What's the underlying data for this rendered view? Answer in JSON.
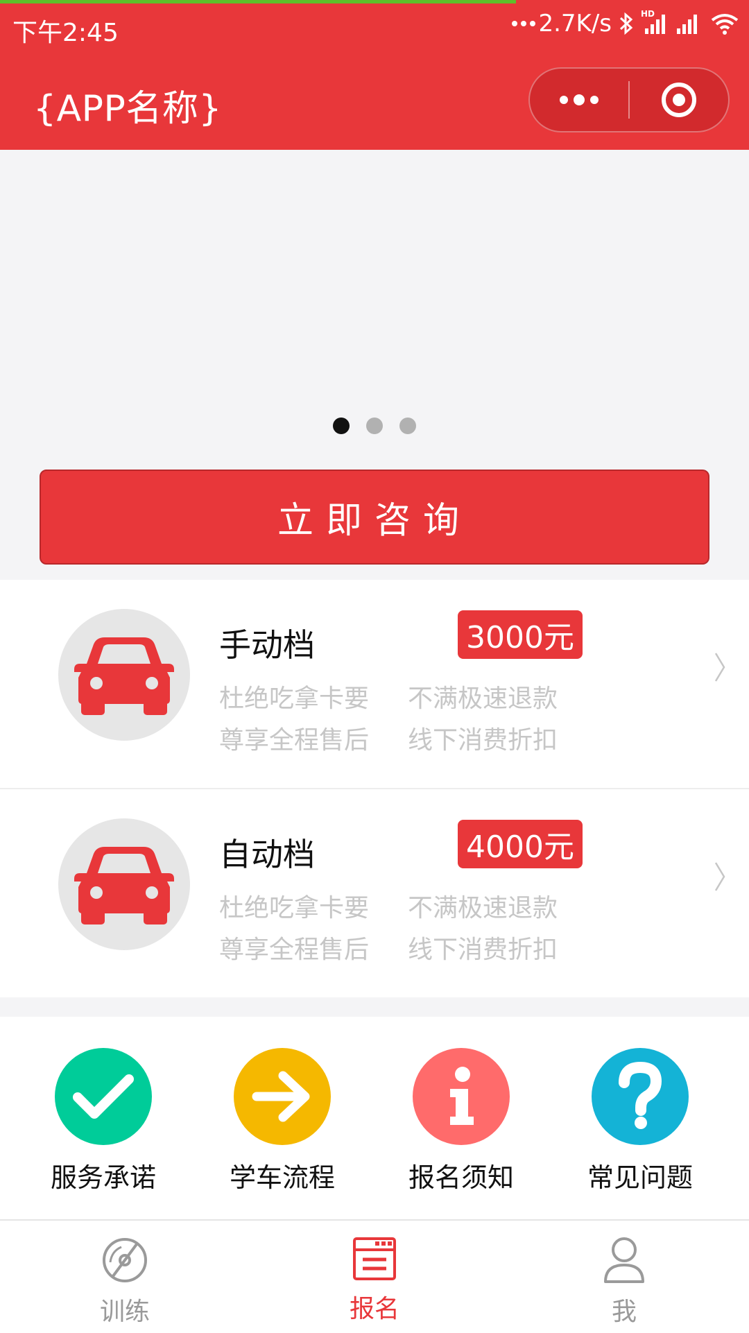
{
  "status_bar": {
    "time": "下午2:45",
    "network_speed": "2.7K/s",
    "hd_badge": "HD"
  },
  "header": {
    "app_title": "{APP名称}",
    "more_icon": "more-dots-icon",
    "close_icon": "target-circle-icon"
  },
  "banner": {
    "pages": 3,
    "active_index": 0
  },
  "consult_button": "立即咨询",
  "courses": [
    {
      "name": "手动档",
      "price": "3000元",
      "features": [
        "杜绝吃拿卡要",
        "不满极速退款",
        "尊享全程售后",
        "线下消费折扣"
      ]
    },
    {
      "name": "自动档",
      "price": "4000元",
      "features": [
        "杜绝吃拿卡要",
        "不满极速退款",
        "尊享全程售后",
        "线下消费折扣"
      ]
    }
  ],
  "services": [
    {
      "label": "服务承诺",
      "icon": "check-icon",
      "color": "#00cc99"
    },
    {
      "label": "学车流程",
      "icon": "arrow-right-icon",
      "color": "#f5b800"
    },
    {
      "label": "报名须知",
      "icon": "info-icon",
      "color": "#ff6b6b"
    },
    {
      "label": "常见问题",
      "icon": "question-icon",
      "color": "#14b3d6"
    }
  ],
  "tabs": [
    {
      "label": "训练",
      "icon": "disc-icon",
      "active": false
    },
    {
      "label": "报名",
      "icon": "register-form-icon",
      "active": true
    },
    {
      "label": "我",
      "icon": "person-icon",
      "active": false
    }
  ],
  "colors": {
    "brand_red": "#e8373a",
    "inactive_gray": "#9a9a9a",
    "feature_gray": "#c6c6c6"
  }
}
